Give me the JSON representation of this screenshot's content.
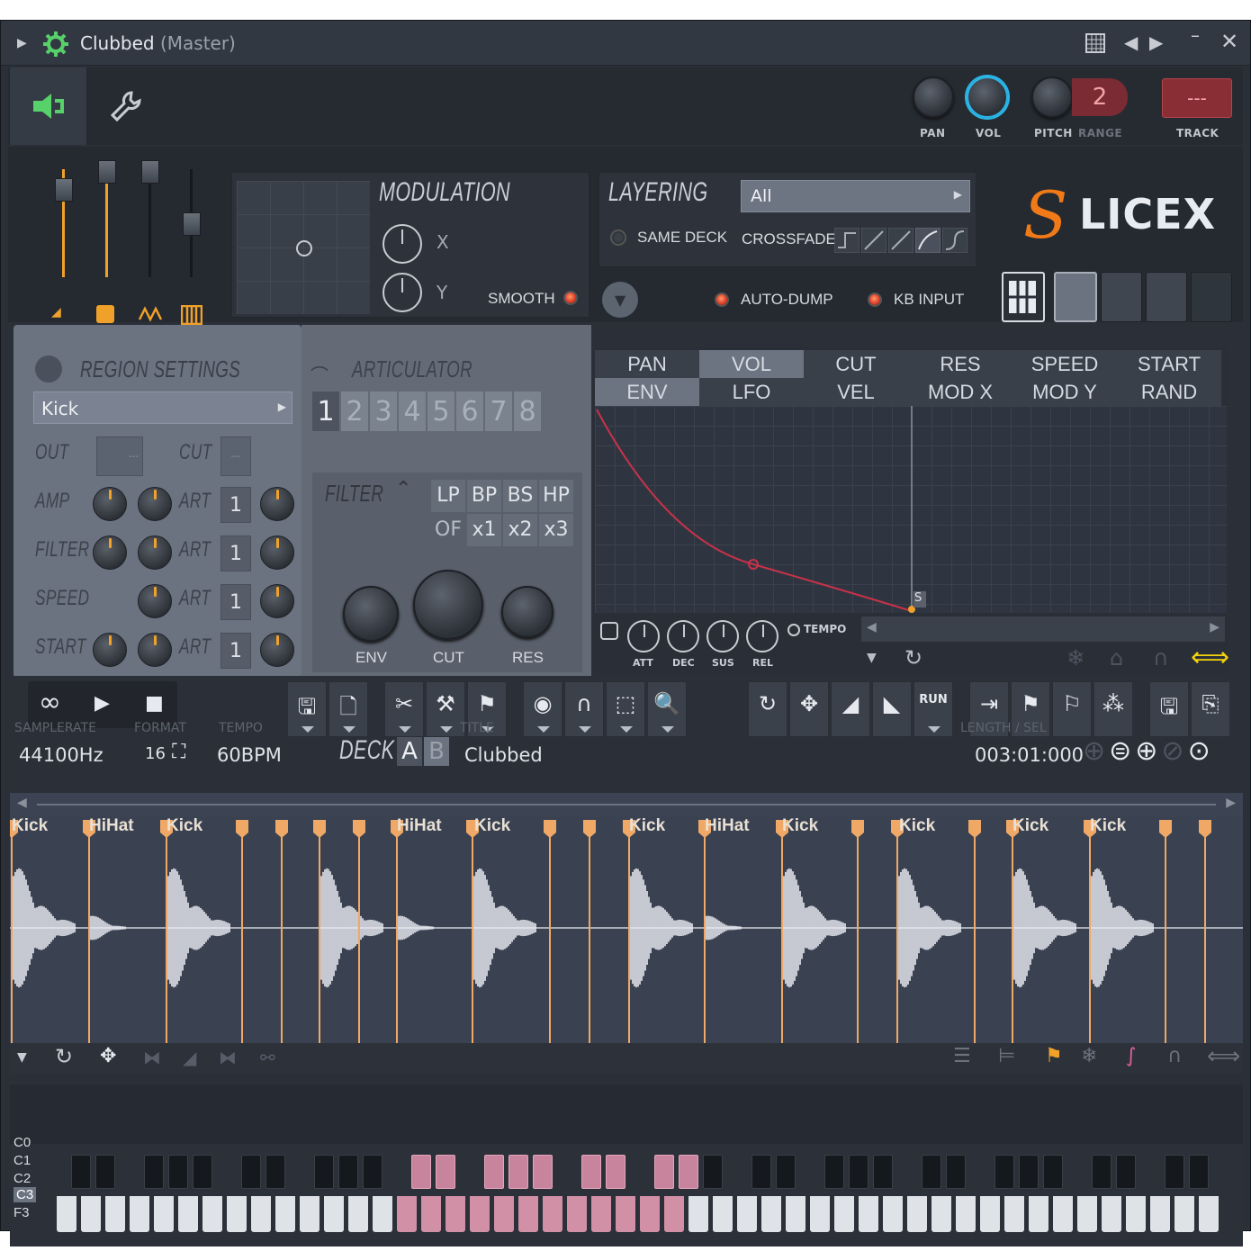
{
  "window": {
    "title": "Clubbed",
    "subtitle": "(Master)"
  },
  "top": {
    "pan": "PAN",
    "vol": "VOL",
    "pitch": "PITCH",
    "range": "RANGE",
    "range_value": "2",
    "track": "TRACK",
    "track_value": "---"
  },
  "modulation": {
    "title": "MODULATION",
    "x": "X",
    "y": "Y",
    "smooth": "SMOOTH"
  },
  "layering": {
    "title": "LAYERING",
    "select": "All",
    "same_deck": "SAME DECK",
    "crossfade": "CROSSFADE",
    "auto_dump": "AUTO-DUMP",
    "kb_input": "KB INPUT"
  },
  "logo": {
    "s": "S",
    "rest": "LICEX"
  },
  "region": {
    "title": "REGION SETTINGS",
    "name": "Kick",
    "out": "OUT",
    "cut": "CUT",
    "amp": "AMP",
    "filter": "FILTER",
    "speed": "SPEED",
    "start": "START",
    "art": "ART",
    "art_vals": [
      "1",
      "1",
      "1",
      "1"
    ],
    "box_dash": "---"
  },
  "articulator": {
    "title": "ARTICULATOR",
    "numbers": [
      "1",
      "2",
      "3",
      "4",
      "5",
      "6",
      "7",
      "8"
    ]
  },
  "filter": {
    "title": "FILTER",
    "types": [
      "LP",
      "BP",
      "BS",
      "HP"
    ],
    "mults": [
      "OF",
      "x1",
      "x2",
      "x3"
    ],
    "env": "ENV",
    "cut": "CUT",
    "res": "RES"
  },
  "env_tabs": {
    "row1": [
      "PAN",
      "VOL",
      "CUT",
      "RES",
      "SPEED",
      "START"
    ],
    "row2": [
      "ENV",
      "LFO",
      "VEL",
      "MOD X",
      "MOD Y",
      "RAND"
    ]
  },
  "env_knobs": {
    "att": "ATT",
    "dec": "DEC",
    "sus": "SUS",
    "rel": "REL",
    "tempo": "TEMPO",
    "marker": "S"
  },
  "info": {
    "samplerate_label": "SAMPLERATE",
    "samplerate": "44100Hz",
    "format_label": "FORMAT",
    "format": "16",
    "tempo_label": "TEMPO",
    "tempo": "60BPM",
    "title_label": "TITLE",
    "deck": "DECK",
    "deck_a": "A",
    "deck_b": "B",
    "title": "Clubbed",
    "length_label": "LENGTH / SEL",
    "length": "003:01:000",
    "run": "RUN"
  },
  "slices": [
    "Kick",
    "HiHat",
    "Kick",
    "HiHat",
    "Kick",
    "Kick",
    "HiHat",
    "Kick",
    "Kick",
    "Kick",
    "Kick"
  ],
  "piano": {
    "octaves": [
      "C0",
      "C1",
      "C2",
      "C3",
      "F3"
    ]
  },
  "colors": {
    "accent_orange": "#f0a12a",
    "led_red": "#e0402a",
    "env_curve": "#c8324a",
    "logo_orange": "#f07a18",
    "piano_pink": "#d190a6",
    "green_icon": "#57d16a"
  }
}
